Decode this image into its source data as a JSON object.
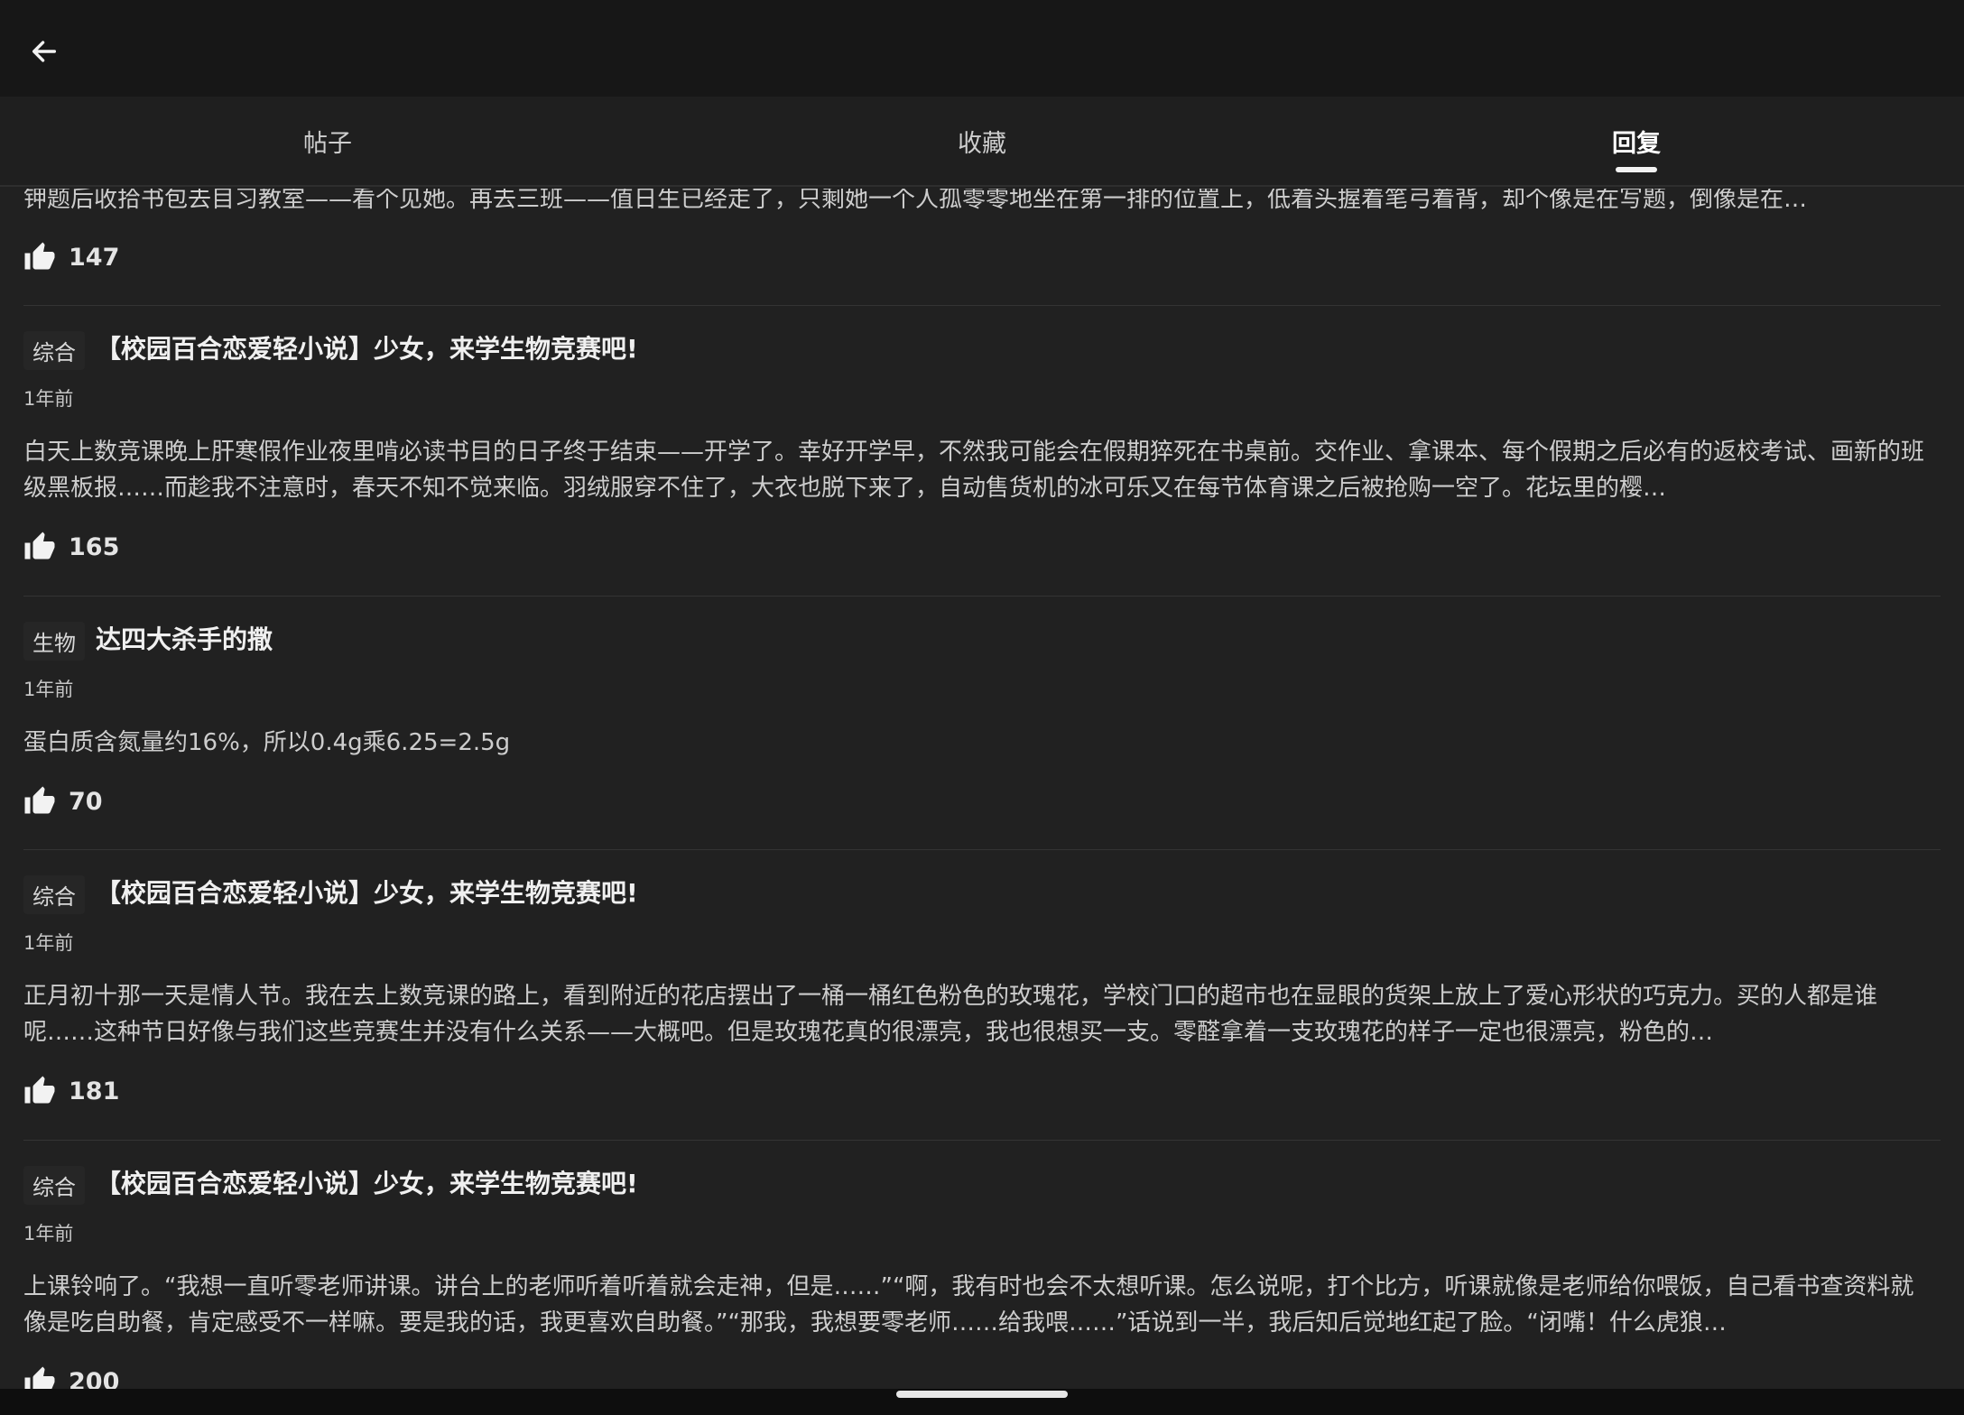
{
  "tabs": [
    {
      "label": "帖子"
    },
    {
      "label": "收藏"
    },
    {
      "label": "回复"
    }
  ],
  "active_tab": 2,
  "items": [
    {
      "body": "钾题后收拾书包去目习教室——看个见她。再去三班——值日生已经走了，只剩她一个人孤零零地坐在第一排的位置上，低着头握着笔弓着背，却个像是在写题，倒像是在…",
      "likes": "147"
    },
    {
      "category": "综合",
      "title": "【校园百合恋爱轻小说】少女，来学生物竞赛吧!",
      "time": "1年前",
      "body": "白天上数竞课晚上肝寒假作业夜里啃必读书目的日子终于结束——开学了。幸好开学早，不然我可能会在假期猝死在书桌前。交作业、拿课本、每个假期之后必有的返校考试、画新的班级黑板报……而趁我不注意时，春天不知不觉来临。羽绒服穿不住了，大衣也脱下来了，自动售货机的冰可乐又在每节体育课之后被抢购一空了。花坛里的樱…",
      "likes": "165"
    },
    {
      "category": "生物",
      "title": "达四大杀手的撒",
      "time": "1年前",
      "body": "蛋白质含氮量约16%，所以0.4g乘6.25=2.5g",
      "likes": "70"
    },
    {
      "category": "综合",
      "title": "【校园百合恋爱轻小说】少女，来学生物竞赛吧!",
      "time": "1年前",
      "body": "正月初十那一天是情人节。我在去上数竞课的路上，看到附近的花店摆出了一桶一桶红色粉色的玫瑰花，学校门口的超市也在显眼的货架上放上了爱心形状的巧克力。买的人都是谁呢……这种节日好像与我们这些竞赛生并没有什么关系——大概吧。但是玫瑰花真的很漂亮，我也很想买一支。零醛拿着一支玫瑰花的样子一定也很漂亮，粉色的…",
      "likes": "181"
    },
    {
      "category": "综合",
      "title": "【校园百合恋爱轻小说】少女，来学生物竞赛吧!",
      "time": "1年前",
      "body": "上课铃响了。“我想一直听零老师讲课。讲台上的老师听着听着就会走神，但是……”“啊，我有时也会不太想听课。怎么说呢，打个比方，听课就像是老师给你喂饭，自己看书查资料就像是吃自助餐，肯定感受不一样嘛。要是我的话，我更喜欢自助餐。”“那我，我想要零老师……给我喂……”话说到一半，我后知后觉地红起了脸。“闭嘴！什么虎狼…",
      "likes": "200"
    }
  ]
}
